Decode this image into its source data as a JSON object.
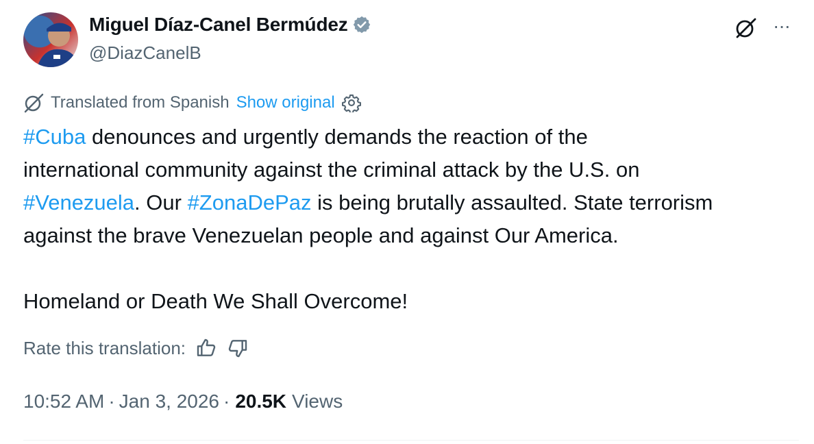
{
  "author": {
    "name": "Miguel Díaz-Canel Bermúdez",
    "handle": "@DiazCanelB",
    "verified_color": "#829aab"
  },
  "translation": {
    "label": "Translated from Spanish",
    "show_original": "Show original"
  },
  "tweet": {
    "line1": {
      "tag": "#Cuba",
      "text": " denounces and urgently demands the reaction of the"
    },
    "line2": {
      "text": "international community against the criminal attack by the U.S. on"
    },
    "line3": {
      "tag1": "#Venezuela",
      "mid": ". Our ",
      "tag2": "#ZonaDePaz",
      "text": " is being brutally assaulted. State terrorism"
    },
    "line4": {
      "text": "against the brave Venezuelan people and against Our America."
    },
    "line5": {
      "text": "Homeland or Death We Shall Overcome!"
    }
  },
  "rate": {
    "label": "Rate this translation:"
  },
  "meta": {
    "time": "10:52 AM",
    "date": "Jan 3, 2026",
    "views_count": "20.5K",
    "views_label": "Views",
    "separator": "·"
  },
  "colors": {
    "link": "#1d9bf0",
    "secondary": "#536471",
    "primary": "#0f1419"
  },
  "icons": [
    "grok-icon",
    "more-icon",
    "translate-icon",
    "gear-icon",
    "thumbs-up-icon",
    "thumbs-down-icon",
    "verified-badge-icon"
  ]
}
